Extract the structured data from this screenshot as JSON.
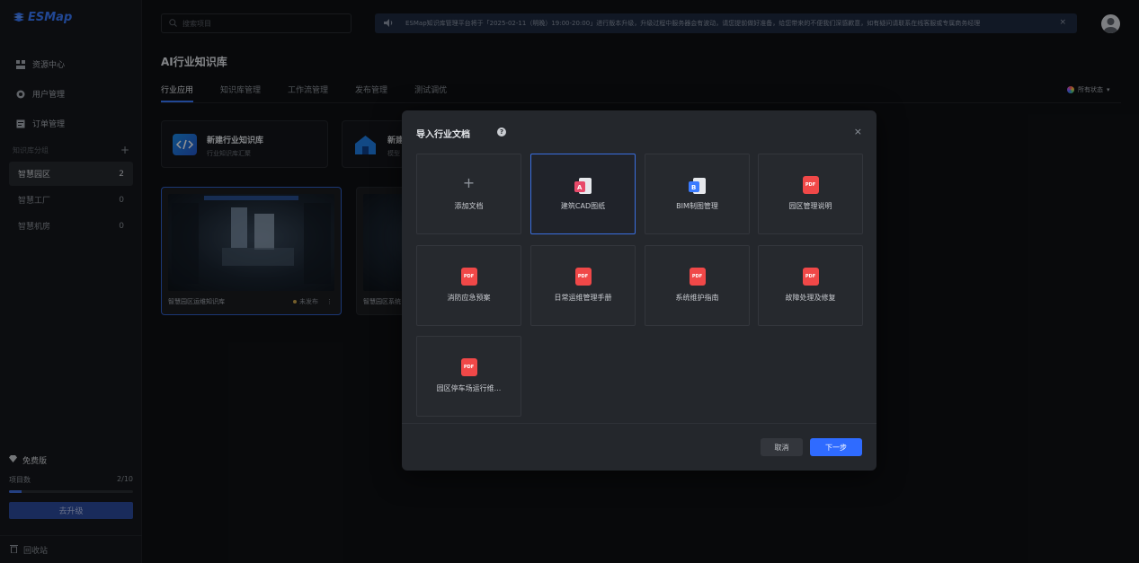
{
  "app": {
    "logo_text": "ESMap"
  },
  "sidebar": {
    "nav": [
      {
        "label": "资源中心",
        "icon": "grid-icon"
      },
      {
        "label": "用户管理",
        "icon": "user-circle-icon"
      },
      {
        "label": "订单管理",
        "icon": "order-icon"
      }
    ],
    "group_header": "知识库分组",
    "groups": [
      {
        "label": "智慧园区",
        "count": "2"
      },
      {
        "label": "智慧工厂",
        "count": "0"
      },
      {
        "label": "智慧机房",
        "count": "0"
      }
    ],
    "plan": {
      "title": "免费版",
      "projects_label": "项目数",
      "projects_value": "2/10",
      "usage": 0.1,
      "upgrade_label": "去升级"
    },
    "recycle_label": "回收站"
  },
  "header": {
    "search_placeholder": "搜索项目",
    "notice": "ESMap知识库管理平台将于「2025-02-11（明晚）19:00-20:00」进行版本升级，升级过程中服务器会有波动，请您提前做好准备，给您带来的不便我们深感歉意，如有疑问请联系在线客服或专属商务经理"
  },
  "main": {
    "title": "AI行业知识库",
    "tabs": [
      "行业应用",
      "知识库管理",
      "工作流管理",
      "发布管理",
      "测试调优"
    ],
    "status_filter": "所有状态",
    "new_cards": [
      {
        "title": "新建行业知识库",
        "subtitle": "行业知识库汇聚"
      },
      {
        "title": "新建",
        "subtitle": "模型"
      }
    ],
    "projects": [
      {
        "name": "智慧园区运维知识库",
        "status": "未发布"
      },
      {
        "name": "智慧园区系统"
      }
    ]
  },
  "modal": {
    "title": "导入行业文档",
    "tiles": [
      {
        "label": "添加文档",
        "icon": "plus-icon"
      },
      {
        "label": "建筑CAD图纸",
        "icon": "cad-file-icon"
      },
      {
        "label": "BIM制图管理",
        "icon": "bim-file-icon"
      },
      {
        "label": "园区管理说明",
        "icon": "pdf-icon"
      },
      {
        "label": "消防应急预案",
        "icon": "pdf-icon"
      },
      {
        "label": "日常运维管理手册",
        "icon": "pdf-icon"
      },
      {
        "label": "系统维护指南",
        "icon": "pdf-icon"
      },
      {
        "label": "故障处理及修复",
        "icon": "pdf-icon"
      },
      {
        "label": "园区停车场运行维...",
        "icon": "pdf-icon"
      }
    ],
    "pdf_badge": "PDF",
    "cancel_label": "取消",
    "next_label": "下一步"
  },
  "colors": {
    "accent": "#2f6bff",
    "pdf": "#f04848",
    "background": "#0f1114"
  }
}
